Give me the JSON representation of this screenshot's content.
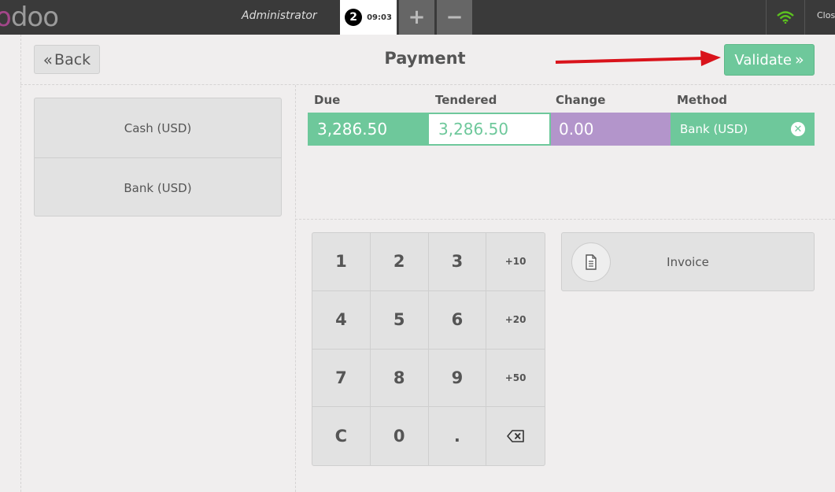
{
  "topbar": {
    "logo": "odoo",
    "user": "Administrator",
    "order_number": "2",
    "order_time": "09:03",
    "add_order_label": "+",
    "remove_order_label": "−",
    "close_label": "Close"
  },
  "header": {
    "back_label": "Back",
    "title": "Payment",
    "validate_label": "Validate"
  },
  "payment_methods": [
    {
      "label": "Cash (USD)"
    },
    {
      "label": "Bank (USD)"
    }
  ],
  "paymentlines": {
    "headers": {
      "due": "Due",
      "tendered": "Tendered",
      "change": "Change",
      "method": "Method"
    },
    "row": {
      "due": "3,286.50",
      "tendered": "3,286.50",
      "change": "0.00",
      "method": "Bank (USD)"
    }
  },
  "numpad": {
    "keys": [
      "1",
      "2",
      "3",
      "+10",
      "4",
      "5",
      "6",
      "+20",
      "7",
      "8",
      "9",
      "+50",
      "C",
      "0",
      ".",
      "⌫"
    ]
  },
  "invoice": {
    "label": "Invoice"
  },
  "colors": {
    "accent_green": "#6ec89b",
    "change_purple": "#b395cb",
    "topbar": "#3a3a3a",
    "arrow_red": "#d9131b"
  }
}
